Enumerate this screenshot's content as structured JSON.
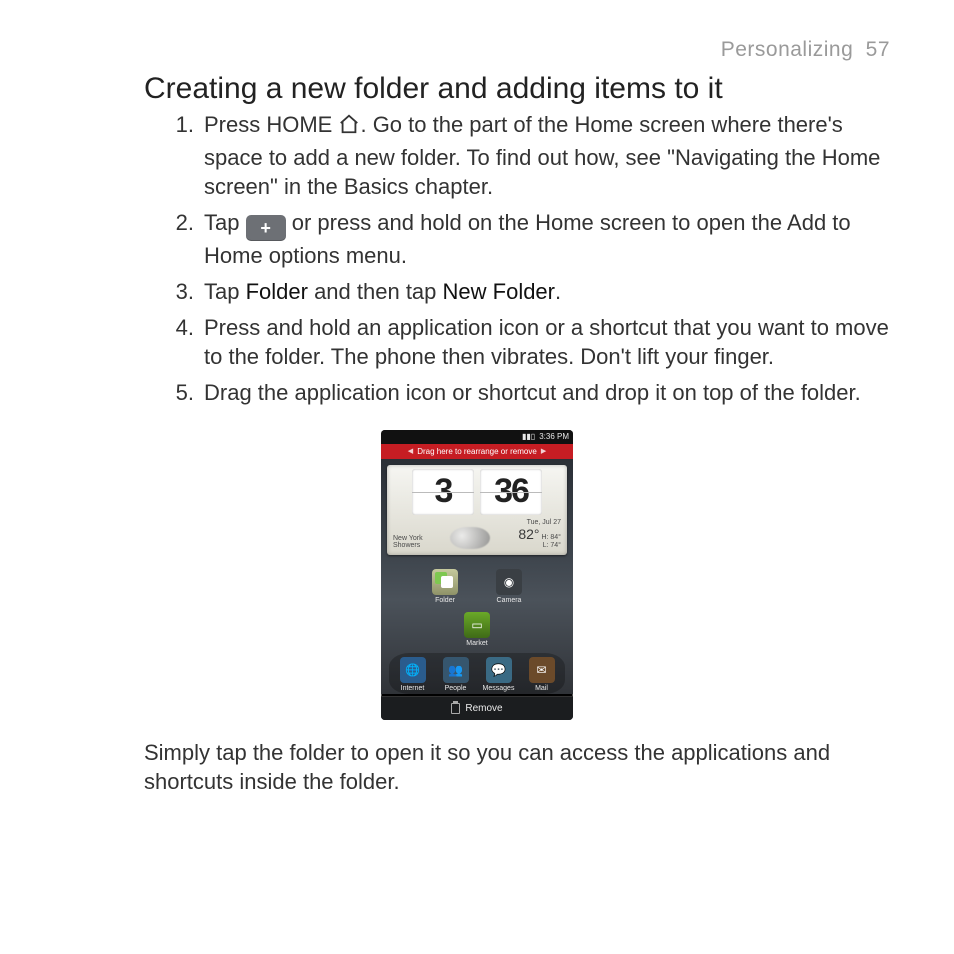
{
  "header": {
    "section": "Personalizing",
    "page_number": "57"
  },
  "title": "Creating a new folder and adding items to it",
  "steps": [
    {
      "n": "1.",
      "pre": "Press HOME ",
      "post": ". Go to the part of the Home screen where there's space to add a new folder. To find out how, see \"Navigating the Home screen\" in the Basics chapter.",
      "icon": "home"
    },
    {
      "n": "2.",
      "pre": "Tap ",
      "post": " or press and hold on the Home screen to open the Add to Home options menu.",
      "icon": "plus"
    },
    {
      "n": "3.",
      "text_parts": [
        "Tap ",
        "Folder",
        " and then tap ",
        "New Folder",
        "."
      ]
    },
    {
      "n": "4.",
      "plain": "Press and hold an application icon or a shortcut that you want to move to the folder. The phone then vibrates. Don't lift your finger."
    },
    {
      "n": "5.",
      "plain": "Drag the application icon or shortcut and drop it on top of the folder."
    }
  ],
  "phone": {
    "status_time": "3:36 PM",
    "redbar_text": "Drag here to rearrange or remove",
    "clock_h": "3",
    "clock_m": "36",
    "city": "New York",
    "cond": "Showers",
    "date": "Tue, Jul 27",
    "temp": "82°",
    "hi": "H: 84°",
    "lo": "L: 74°",
    "apps_mid": [
      {
        "label": "Folder",
        "cls": "ic-folder"
      },
      {
        "label": "Camera",
        "cls": "ic-cam"
      }
    ],
    "apps_mid2": [
      {
        "label": "Market",
        "cls": "ic-mkt"
      }
    ],
    "dock": [
      {
        "label": "Internet",
        "cls": "ic-int"
      },
      {
        "label": "People",
        "cls": "ic-ppl"
      },
      {
        "label": "Messages",
        "cls": "ic-msg"
      },
      {
        "label": "Mail",
        "cls": "ic-mail"
      }
    ],
    "remove": "Remove"
  },
  "closing": "Simply tap the folder to open it so you can access the applications and shortcuts inside the folder."
}
